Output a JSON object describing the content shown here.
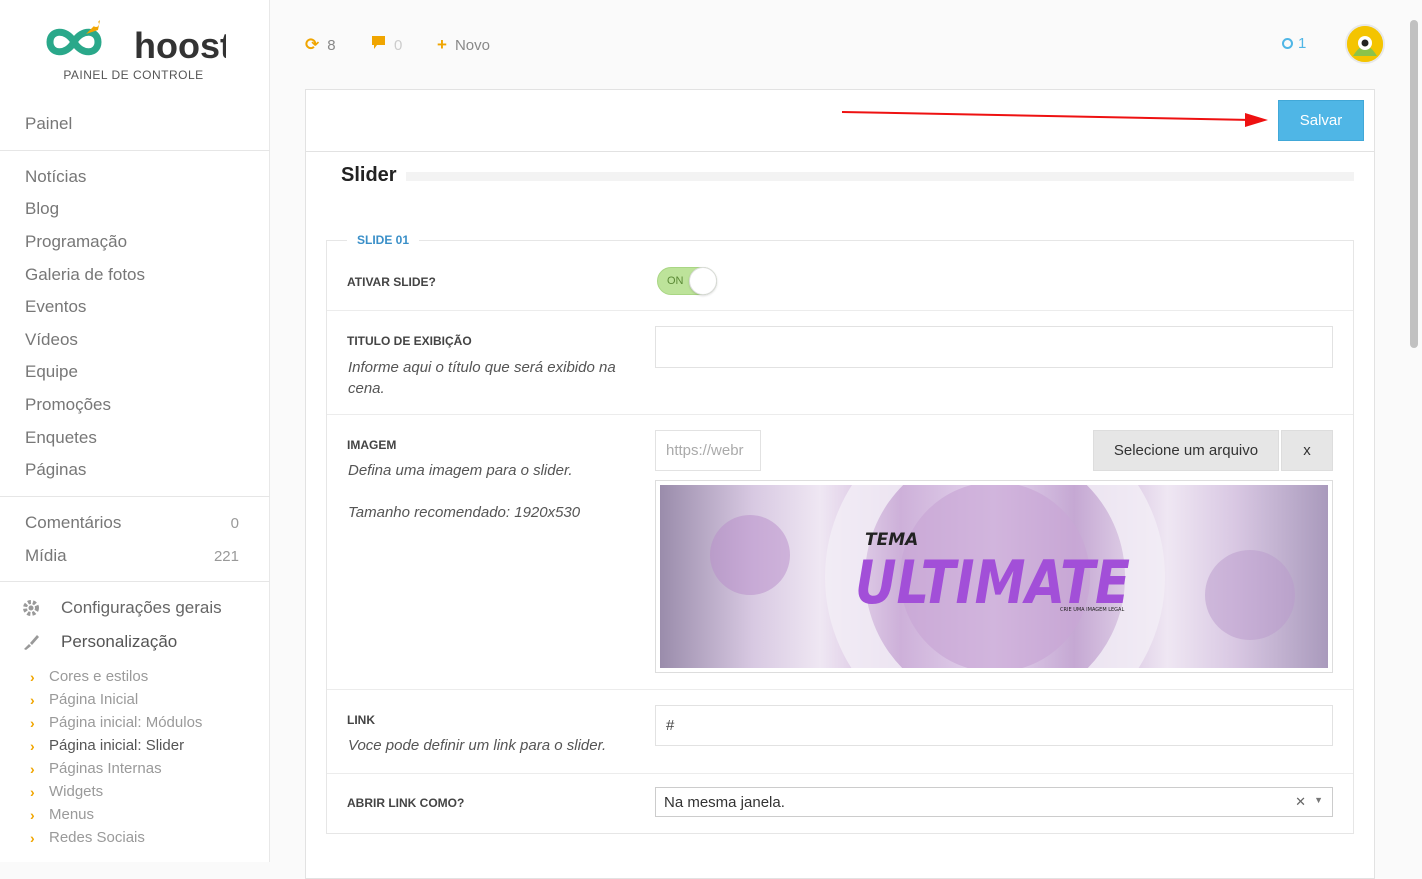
{
  "brand": {
    "name": "hoost",
    "subtitle": "PAINEL DE CONTROLE"
  },
  "sidebar": {
    "primary": [
      {
        "label": "Painel"
      }
    ],
    "content": [
      {
        "label": "Notícias"
      },
      {
        "label": "Blog"
      },
      {
        "label": "Programação"
      },
      {
        "label": "Galeria de fotos"
      },
      {
        "label": "Eventos"
      },
      {
        "label": "Vídeos"
      },
      {
        "label": "Equipe"
      },
      {
        "label": "Promoções"
      },
      {
        "label": "Enquetes"
      },
      {
        "label": "Páginas"
      }
    ],
    "counted": [
      {
        "label": "Comentários",
        "count": "0"
      },
      {
        "label": "Mídia",
        "count": "221"
      }
    ],
    "settings": [
      {
        "label": "Configurações gerais",
        "icon": "gear-icon"
      },
      {
        "label": "Personalização",
        "icon": "brush-icon"
      }
    ],
    "submenu": [
      {
        "label": "Cores e estilos"
      },
      {
        "label": "Página Inicial"
      },
      {
        "label": "Página inicial: Módulos"
      },
      {
        "label": "Página inicial: Slider",
        "active": true
      },
      {
        "label": "Páginas Internas"
      },
      {
        "label": "Widgets"
      },
      {
        "label": "Menus"
      },
      {
        "label": "Redes Sociais"
      }
    ]
  },
  "topbar": {
    "updates": "8",
    "comments": "0",
    "new_label": "Novo",
    "notifications": "1"
  },
  "panel": {
    "save_label": "Salvar",
    "section_title": "Slider",
    "slide": {
      "legend": "SLIDE 01",
      "activate_label": "ATIVAR SLIDE?",
      "toggle_state": "ON",
      "title_label": "TITULO DE EXIBIÇÃO",
      "title_help": "Informe aqui o título que será exibido na cena.",
      "title_value": "",
      "image_label": "IMAGEM",
      "image_help": "Defina uma imagem para o slider.",
      "image_size_help": "Tamanho recomendado: 1920x530",
      "image_url": "https://webr",
      "select_file_label": "Selecione um arquivo",
      "clear_label": "x",
      "image_title_small": "TEMA",
      "image_title_big": "ULTIMATE",
      "image_tagline": "CRIE UMA IMAGEM LEGAL",
      "link_label": "LINK",
      "link_help": "Voce pode definir um link para o slider.",
      "link_value": "#",
      "open_label": "ABRIR LINK COMO?",
      "open_value": "Na mesma janela."
    }
  },
  "colors": {
    "accent": "#4fb6e6",
    "brand_green": "#2aa88a",
    "brand_orange": "#f0a500",
    "legend_blue": "#3a8fc8"
  }
}
